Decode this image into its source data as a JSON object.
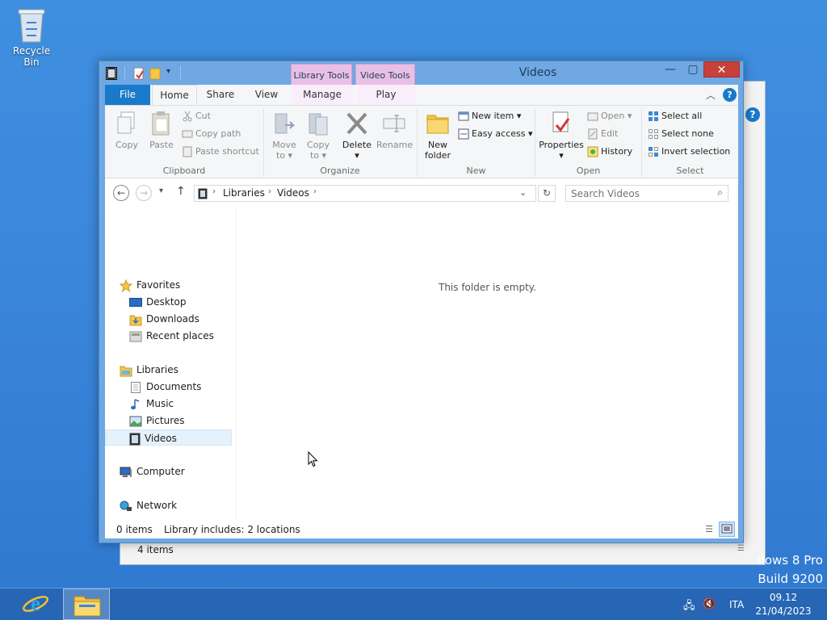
{
  "desktop": {
    "recycle_bin": "Recycle Bin",
    "watermark_line1": "dows 8 Pro",
    "watermark_line2": "Build 9200"
  },
  "window": {
    "title": "Videos",
    "context_tabs": [
      "Library Tools",
      "Video Tools"
    ]
  },
  "ribbon_tabs": {
    "file": "File",
    "home": "Home",
    "share": "Share",
    "view": "View",
    "manage": "Manage",
    "play": "Play"
  },
  "ribbon": {
    "clipboard": {
      "label": "Clipboard",
      "copy": "Copy",
      "paste": "Paste",
      "cut": "Cut",
      "copy_path": "Copy path",
      "paste_shortcut": "Paste shortcut"
    },
    "organize": {
      "label": "Organize",
      "move_to_1": "Move",
      "move_to_2": "to",
      "copy_to_1": "Copy",
      "copy_to_2": "to",
      "delete": "Delete",
      "rename": "Rename"
    },
    "new": {
      "label": "New",
      "new_folder_1": "New",
      "new_folder_2": "folder",
      "new_item": "New item",
      "easy_access": "Easy access"
    },
    "open": {
      "label": "Open",
      "properties": "Properties",
      "open": "Open",
      "edit": "Edit",
      "history": "History"
    },
    "select": {
      "label": "Select",
      "select_all": "Select all",
      "select_none": "Select none",
      "invert_selection": "Invert selection"
    }
  },
  "address": {
    "crumbs": [
      "Libraries",
      "Videos"
    ],
    "search_placeholder": "Search Videos"
  },
  "navigation": {
    "favorites": "Favorites",
    "favorites_items": [
      "Desktop",
      "Downloads",
      "Recent places"
    ],
    "libraries": "Libraries",
    "libraries_items": [
      "Documents",
      "Music",
      "Pictures",
      "Videos"
    ],
    "computer": "Computer",
    "network": "Network"
  },
  "main": {
    "empty_message": "This folder is empty."
  },
  "status": {
    "items": "0 items",
    "library_info": "Library includes: 2 locations",
    "background_items": "4 items"
  },
  "taskbar": {
    "language": "ITA",
    "time": "09.12",
    "date": "21/04/2023"
  },
  "colors": {
    "file_tab": "#1979ca",
    "context_tab": "#e8c0e6",
    "close_button": "#c7403a",
    "selection": "#e5f1fb"
  }
}
